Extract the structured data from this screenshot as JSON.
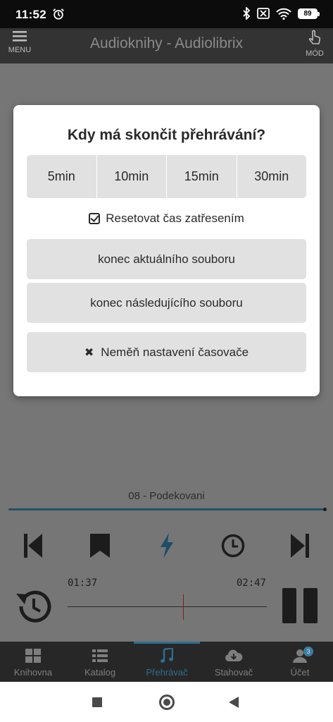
{
  "status_bar": {
    "time": "11:52",
    "battery": "89",
    "icons": [
      "alarm-icon",
      "bluetooth-icon",
      "sim-off-icon",
      "wifi-icon",
      "battery-icon"
    ]
  },
  "app_bar": {
    "menu_label": "MENU",
    "title": "Audioknihy - Audiolibrix",
    "mode_label": "MÓD"
  },
  "dialog": {
    "title": "Kdy má skončit přehrávání?",
    "durations": [
      "5min",
      "10min",
      "15min",
      "30min"
    ],
    "reset_label": "Resetovat čas zatřesením",
    "reset_checked": true,
    "end_current": "konec aktuálního souboru",
    "end_next": "konec následujícího souboru",
    "keep_label": "Neměň nastavení časovače"
  },
  "player": {
    "track": "08 - Podekovani",
    "elapsed": "01:37",
    "total": "02:47",
    "progress_fraction": 0.58
  },
  "bottom_nav": {
    "items": [
      {
        "label": "Knihovna",
        "icon": "grid-icon"
      },
      {
        "label": "Katalog",
        "icon": "list-icon"
      },
      {
        "label": "Přehrávač",
        "icon": "music-note-icon"
      },
      {
        "label": "Stahovač",
        "icon": "cloud-download-icon"
      },
      {
        "label": "Účet",
        "icon": "account-icon"
      }
    ],
    "active_index": 2,
    "account_badge": "3"
  },
  "colors": {
    "accent": "#2f6d8e",
    "app_bar": "#333333",
    "overlay": "#767676",
    "button": "#e1e1e1"
  }
}
